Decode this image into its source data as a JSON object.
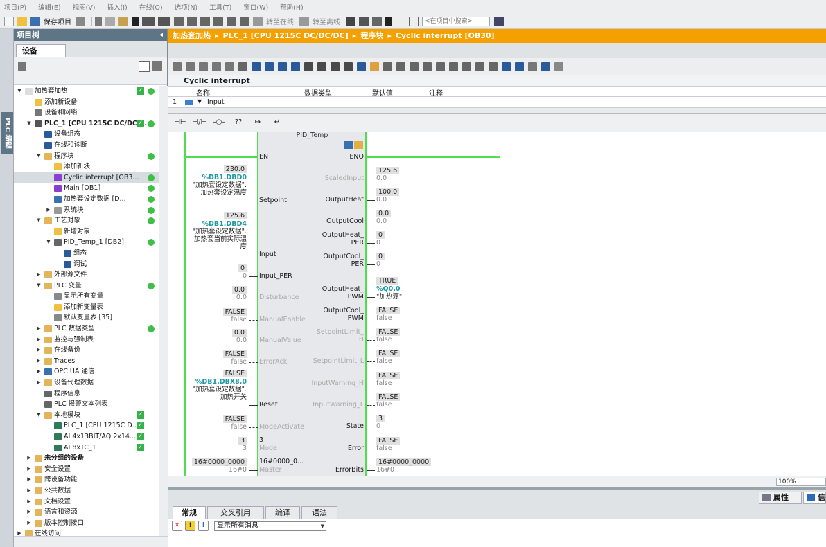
{
  "menu": [
    "项目(P)",
    "编辑(E)",
    "视图(V)",
    "插入(I)",
    "在线(O)",
    "选项(N)",
    "工具(T)",
    "窗口(W)",
    "帮助(H)"
  ],
  "toolbar": {
    "save_project": "保存项目",
    "go_online": "转至在线",
    "go_offline": "转至离线",
    "search_placeholder": "<在项目中搜索>"
  },
  "vertical_tab": "PLC 编程",
  "project_tree": {
    "title": "项目树",
    "tab": "设备",
    "items": [
      {
        "label": "加热套加热",
        "indent": 0,
        "arrow": "▼",
        "icon": "project-icon",
        "status": "ok-dot"
      },
      {
        "label": "添加新设备",
        "indent": 1,
        "arrow": "",
        "icon": "add-device-icon",
        "status": ""
      },
      {
        "label": "设备和网络",
        "indent": 1,
        "arrow": "",
        "icon": "network-icon",
        "status": ""
      },
      {
        "label": "PLC_1 [CPU 1215C DC/DC/...",
        "indent": 1,
        "arrow": "▼",
        "icon": "plc-icon",
        "status": "ok-dot",
        "bold": true
      },
      {
        "label": "设备组态",
        "indent": 2,
        "arrow": "",
        "icon": "device-config-icon",
        "status": ""
      },
      {
        "label": "在线和诊断",
        "indent": 2,
        "arrow": "",
        "icon": "diagnostics-icon",
        "status": ""
      },
      {
        "label": "程序块",
        "indent": 2,
        "arrow": "▼",
        "icon": "folder-icon",
        "status": "dot"
      },
      {
        "label": "添加新块",
        "indent": 3,
        "arrow": "",
        "icon": "add-block-icon",
        "status": ""
      },
      {
        "label": "Cyclic interrupt [OB3...",
        "indent": 3,
        "arrow": "",
        "icon": "ob-icon",
        "status": "dot",
        "selected": true
      },
      {
        "label": "Main [OB1]",
        "indent": 3,
        "arrow": "",
        "icon": "ob-icon",
        "status": "dot"
      },
      {
        "label": "加热套设定数据 [D...",
        "indent": 3,
        "arrow": "",
        "icon": "db-icon",
        "status": "dot"
      },
      {
        "label": "系统块",
        "indent": 3,
        "arrow": "▶",
        "icon": "system-block-icon",
        "status": "dot"
      },
      {
        "label": "工艺对象",
        "indent": 2,
        "arrow": "▼",
        "icon": "folder-icon",
        "status": "dot"
      },
      {
        "label": "新增对象",
        "indent": 3,
        "arrow": "",
        "icon": "add-object-icon",
        "status": ""
      },
      {
        "label": "PID_Temp_1 [DB2]",
        "indent": 3,
        "arrow": "▼",
        "icon": "pid-icon",
        "status": "dot"
      },
      {
        "label": "组态",
        "indent": 4,
        "arrow": "",
        "icon": "config-icon",
        "status": ""
      },
      {
        "label": "调试",
        "indent": 4,
        "arrow": "",
        "icon": "commissioning-icon",
        "status": ""
      },
      {
        "label": "外部源文件",
        "indent": 2,
        "arrow": "▶",
        "icon": "folder-icon",
        "status": ""
      },
      {
        "label": "PLC 变量",
        "indent": 2,
        "arrow": "▼",
        "icon": "folder-icon",
        "status": "dot"
      },
      {
        "label": "显示所有变量",
        "indent": 3,
        "arrow": "",
        "icon": "tag-table-icon",
        "status": ""
      },
      {
        "label": "添加新变量表",
        "indent": 3,
        "arrow": "",
        "icon": "add-tag-table-icon",
        "status": ""
      },
      {
        "label": "默认变量表 [35]",
        "indent": 3,
        "arrow": "",
        "icon": "tag-table-icon",
        "status": ""
      },
      {
        "label": "PLC 数据类型",
        "indent": 2,
        "arrow": "▶",
        "icon": "folder-icon",
        "status": "dot"
      },
      {
        "label": "监控与强制表",
        "indent": 2,
        "arrow": "▶",
        "icon": "folder-icon",
        "status": ""
      },
      {
        "label": "在线备份",
        "indent": 2,
        "arrow": "▶",
        "icon": "folder-icon",
        "status": ""
      },
      {
        "label": "Traces",
        "indent": 2,
        "arrow": "▶",
        "icon": "folder-icon",
        "status": ""
      },
      {
        "label": "OPC UA 通信",
        "indent": 2,
        "arrow": "▶",
        "icon": "opc-icon",
        "status": ""
      },
      {
        "label": "设备代理数据",
        "indent": 2,
        "arrow": "▶",
        "icon": "folder-icon",
        "status": ""
      },
      {
        "label": "程序信息",
        "indent": 2,
        "arrow": "",
        "icon": "program-info-icon",
        "status": ""
      },
      {
        "label": "PLC 报警文本列表",
        "indent": 2,
        "arrow": "",
        "icon": "alarm-text-icon",
        "status": ""
      },
      {
        "label": "本地模块",
        "indent": 2,
        "arrow": "▼",
        "icon": "folder-icon",
        "status": "ok"
      },
      {
        "label": "PLC_1 [CPU 1215C D...",
        "indent": 3,
        "arrow": "",
        "icon": "module-icon",
        "status": "ok"
      },
      {
        "label": "AI 4x13BIT/AQ 2x14...",
        "indent": 3,
        "arrow": "",
        "icon": "module-icon",
        "status": "ok"
      },
      {
        "label": "AI 8xTC_1",
        "indent": 3,
        "arrow": "",
        "icon": "module-icon",
        "status": "ok"
      },
      {
        "label": "未分组的设备",
        "indent": 1,
        "arrow": "▶",
        "icon": "folder-icon",
        "status": "",
        "bold": true
      },
      {
        "label": "安全设置",
        "indent": 1,
        "arrow": "▶",
        "icon": "security-icon",
        "status": ""
      },
      {
        "label": "跨设备功能",
        "indent": 1,
        "arrow": "▶",
        "icon": "cross-device-icon",
        "status": ""
      },
      {
        "label": "公共数据",
        "indent": 1,
        "arrow": "▶",
        "icon": "folder-icon",
        "status": ""
      },
      {
        "label": "文档设置",
        "indent": 1,
        "arrow": "▶",
        "icon": "folder-icon",
        "status": ""
      },
      {
        "label": "语言和资源",
        "indent": 1,
        "arrow": "▶",
        "icon": "folder-icon",
        "status": ""
      },
      {
        "label": "版本控制接口",
        "indent": 1,
        "arrow": "▶",
        "icon": "folder-icon",
        "status": ""
      },
      {
        "label": "在线访问",
        "indent": 0,
        "arrow": "▶",
        "icon": "folder-icon",
        "status": ""
      }
    ]
  },
  "breadcrumb": [
    "加热套加热",
    "PLC_1 [CPU 1215C DC/DC/DC]",
    "程序块",
    "Cyclic interrupt [OB30]"
  ],
  "block_name": "Cyclic interrupt",
  "interface": {
    "headers": [
      "名称",
      "数据类型",
      "默认值",
      "注释"
    ],
    "row_num": "1",
    "row_label": "Input"
  },
  "ladder_toolbar": [
    "⊣⊢",
    "⊣/⊢",
    "–○–",
    "??",
    "↦",
    "↵"
  ],
  "fb": {
    "title": "PID_Temp",
    "left": [
      {
        "name": "EN",
        "val": "",
        "addr": "",
        "tag": [],
        "sub": "",
        "dim": false,
        "dashed": false
      },
      {
        "name": "Setpoint",
        "val": "230.0",
        "addr": "%DB1.DBD0",
        "tag": [
          "\"加热套设定数据\".",
          "加热套设定温度"
        ],
        "sub": "",
        "dim": false,
        "dashed": false
      },
      {
        "name": "Input",
        "val": "125.6",
        "addr": "%DB1.DBD4",
        "tag": [
          "\"加热套设定数据\".",
          "加热套当前实际温",
          "度"
        ],
        "sub": "",
        "dim": false,
        "dashed": false
      },
      {
        "name": "Input_PER",
        "val": "0",
        "addr": "",
        "tag": [],
        "sub": "0",
        "dim": false,
        "dashed": false
      },
      {
        "name": "Disturbance",
        "val": "0.0",
        "addr": "",
        "tag": [],
        "sub": "0.0",
        "dim": true,
        "dashed": false
      },
      {
        "name": "ManualEnable",
        "val": "FALSE",
        "addr": "",
        "tag": [],
        "sub": "false",
        "dim": true,
        "dashed": true
      },
      {
        "name": "ManualValue",
        "val": "0.0",
        "addr": "",
        "tag": [],
        "sub": "0.0",
        "dim": true,
        "dashed": false
      },
      {
        "name": "ErrorAck",
        "val": "FALSE",
        "addr": "",
        "tag": [],
        "sub": "false",
        "dim": true,
        "dashed": true
      },
      {
        "name": "Reset",
        "val": "FALSE",
        "addr": "%DB1.DBX8.0",
        "tag": [
          "\"加热套设定数据\".",
          "加热开关"
        ],
        "sub": "",
        "dim": false,
        "dashed": false
      },
      {
        "name": "ModeActivate",
        "val": "FALSE",
        "addr": "",
        "tag": [],
        "sub": "false",
        "dim": true,
        "dashed": true
      },
      {
        "name": "Mode",
        "val": "3",
        "addr": "",
        "tag": [],
        "sub": "3",
        "dim": true,
        "dashed": false,
        "inner": "3"
      },
      {
        "name": "Master",
        "val": "16#0000_0000",
        "addr": "",
        "tag": [],
        "sub": "16#0",
        "dim": true,
        "dashed": false,
        "inner": "16#0000_0..."
      }
    ],
    "right": [
      {
        "name": "ENO",
        "val": "",
        "sub": "",
        "addr": "",
        "tag": "",
        "dim": false,
        "dashed": false
      },
      {
        "name": "ScaledInput",
        "val": "125.6",
        "sub": "0.0",
        "addr": "",
        "tag": "",
        "dim": true,
        "dashed": false
      },
      {
        "name": "OutputHeat",
        "val": "100.0",
        "sub": "0.0",
        "addr": "",
        "tag": "",
        "dim": false,
        "dashed": false
      },
      {
        "name": "OutputCool",
        "val": "0.0",
        "sub": "0.0",
        "addr": "",
        "tag": "",
        "dim": false,
        "dashed": false
      },
      {
        "name": "OutputHeat_\nPER",
        "val": "0",
        "sub": "0",
        "addr": "",
        "tag": "",
        "dim": false,
        "dashed": false
      },
      {
        "name": "OutputCool_\nPER",
        "val": "0",
        "sub": "0",
        "addr": "",
        "tag": "",
        "dim": false,
        "dashed": false
      },
      {
        "name": "OutputHeat_\nPWM",
        "val": "TRUE",
        "sub": "",
        "addr": "%Q0.0",
        "tag": "\"加热源\"",
        "dim": false,
        "dashed": false
      },
      {
        "name": "OutputCool_\nPWM",
        "val": "FALSE",
        "sub": "false",
        "addr": "",
        "tag": "",
        "dim": false,
        "dashed": true
      },
      {
        "name": "SetpointLimit_\nH",
        "val": "FALSE",
        "sub": "false",
        "addr": "",
        "tag": "",
        "dim": true,
        "dashed": true
      },
      {
        "name": "SetpointLimit_L",
        "val": "FALSE",
        "sub": "false",
        "addr": "",
        "tag": "",
        "dim": true,
        "dashed": true
      },
      {
        "name": "InputWarning_H",
        "val": "FALSE",
        "sub": "false",
        "addr": "",
        "tag": "",
        "dim": true,
        "dashed": true
      },
      {
        "name": "InputWarning_L",
        "val": "FALSE",
        "sub": "false",
        "addr": "",
        "tag": "",
        "dim": true,
        "dashed": true
      },
      {
        "name": "State",
        "val": "3",
        "sub": "0",
        "addr": "",
        "tag": "",
        "dim": false,
        "dashed": false
      },
      {
        "name": "Error",
        "val": "FALSE",
        "sub": "false",
        "addr": "",
        "tag": "",
        "dim": false,
        "dashed": true
      },
      {
        "name": "ErrorBits",
        "val": "16#0000_0000",
        "sub": "16#0",
        "addr": "",
        "tag": "",
        "dim": false,
        "dashed": false
      }
    ]
  },
  "zoom": "100%",
  "inspector": {
    "properties": "属性",
    "info": "信",
    "tabs": [
      "常规",
      "交叉引用",
      "编译",
      "语法"
    ],
    "filter": "显示所有消息"
  },
  "colors": {
    "accent": "#f4a100",
    "header": "#5d7585",
    "energized": "#4ddd4d",
    "status_ok": "#35b24a"
  }
}
